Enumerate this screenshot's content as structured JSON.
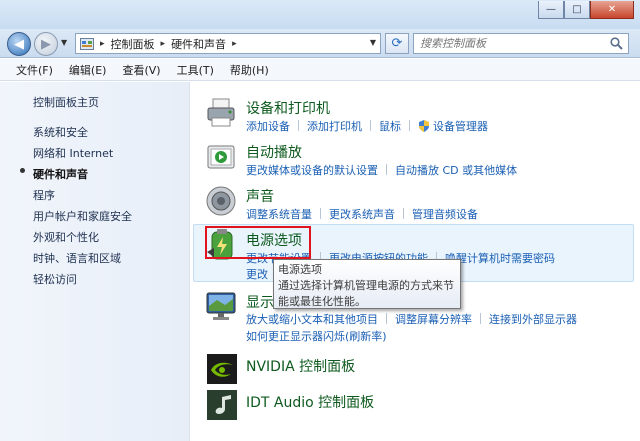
{
  "window": {
    "min": "—",
    "max": "□",
    "close": "✕"
  },
  "address": {
    "crumbs": [
      "控制面板",
      "硬件和声音"
    ],
    "search_placeholder": "搜索控制面板"
  },
  "menu": [
    "文件(F)",
    "编辑(E)",
    "查看(V)",
    "工具(T)",
    "帮助(H)"
  ],
  "left_nav": [
    {
      "label": "控制面板主页",
      "current": false
    },
    {
      "label": "系统和安全",
      "current": false
    },
    {
      "label": "网络和 Internet",
      "current": false
    },
    {
      "label": "硬件和声音",
      "current": true
    },
    {
      "label": "程序",
      "current": false
    },
    {
      "label": "用户帐户和家庭安全",
      "current": false
    },
    {
      "label": "外观和个性化",
      "current": false
    },
    {
      "label": "时钟、语言和区域",
      "current": false
    },
    {
      "label": "轻松访问",
      "current": false
    }
  ],
  "categories": [
    {
      "title": "设备和打印机",
      "icon": "printer-icon",
      "links": [
        "添加设备",
        "添加打印机",
        "鼠标",
        "设备管理器"
      ]
    },
    {
      "title": "自动播放",
      "icon": "autoplay-icon",
      "links": [
        "更改媒体或设备的默认设置",
        "自动播放 CD 或其他媒体"
      ]
    },
    {
      "title": "声音",
      "icon": "speaker-icon",
      "links": [
        "调整系统音量",
        "更改系统声音",
        "管理音频设备"
      ]
    },
    {
      "title": "电源选项",
      "icon": "battery-icon",
      "links": [
        "更改节能设置",
        "更改电源按钮的功能",
        "唤醒计算机时需要密码"
      ],
      "links2": [
        "更改"
      ]
    },
    {
      "title": "显示",
      "icon": "display-icon",
      "links": [
        "放大或缩小文本和其他项目",
        "调整屏幕分辨率",
        "连接到外部显示器"
      ],
      "links2": [
        "如何更正显示器闪烁(刷新率)"
      ]
    },
    {
      "title": "NVIDIA 控制面板",
      "icon": "nvidia-icon",
      "links": []
    },
    {
      "title": "IDT Audio 控制面板",
      "icon": "idt-audio-icon",
      "links": []
    }
  ],
  "tooltip": {
    "title": "电源选项",
    "line1": "通过选择计算机管理电源的方式来节",
    "line2": "能或最佳化性能。"
  },
  "colors": {
    "link": "#1a5fb4",
    "title": "#0e5a1e",
    "highlight": "#e0141e"
  }
}
